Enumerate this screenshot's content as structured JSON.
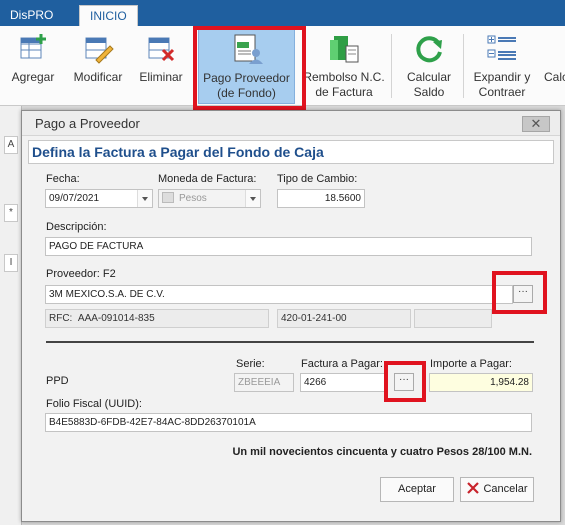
{
  "ribbon": {
    "app_tab": "DisPRO",
    "active_tab": "INICIO",
    "buttons": {
      "agregar": "Agregar",
      "modificar": "Modificar",
      "eliminar": "Eliminar",
      "pago_l1": "Pago Proveedor",
      "pago_l2": "(de Fondo)",
      "rembolso_l1": "Rembolso N.C.",
      "rembolso_l2": "de Factura",
      "calcular_l1": "Calcular",
      "calcular_l2": "Saldo",
      "expandir_l1": "Expandir y",
      "expandir_l2": "Contraer",
      "calc_partial": "Calc"
    }
  },
  "dialog": {
    "title": "Pago a Proveedor",
    "close_glyph": "✕",
    "heading": "Defina la Factura a Pagar del Fondo de Caja",
    "fecha_label": "Fecha:",
    "fecha_value": "09/07/2021",
    "moneda_label": "Moneda de Factura:",
    "moneda_value": "Pesos",
    "tipo_label": "Tipo de Cambio:",
    "tipo_value": "18.5600",
    "descripcion_label": "Descripción:",
    "descripcion_value": "PAGO DE FACTURA",
    "proveedor_label": "Proveedor: F2",
    "proveedor_value": "3M MEXICO.S.A. DE C.V.",
    "ellipsis": "···",
    "rfc_label": "RFC:",
    "rfc_value": "AAA-091014-835",
    "cuenta_value": "420-01-241-00",
    "ppd_label": "PPD",
    "serie_label": "Serie:",
    "serie_value": "ZBEEEIA",
    "factura_label": "Factura a Pagar:",
    "factura_value": "4266",
    "importe_label": "Importe a Pagar:",
    "importe_value": "1,954.28",
    "folio_label": "Folio Fiscal (UUID):",
    "folio_value": "B4E5883D-6FDB-42E7-84AC-8DD26370101A",
    "amount_words": "Un mil novecientos cincuenta y cuatro Pesos  28/100  M.N.",
    "aceptar": "Aceptar",
    "cancelar": "Cancelar"
  },
  "background": {
    "cell_1": "A",
    "cell_2": "*",
    "cell_3": "I"
  }
}
